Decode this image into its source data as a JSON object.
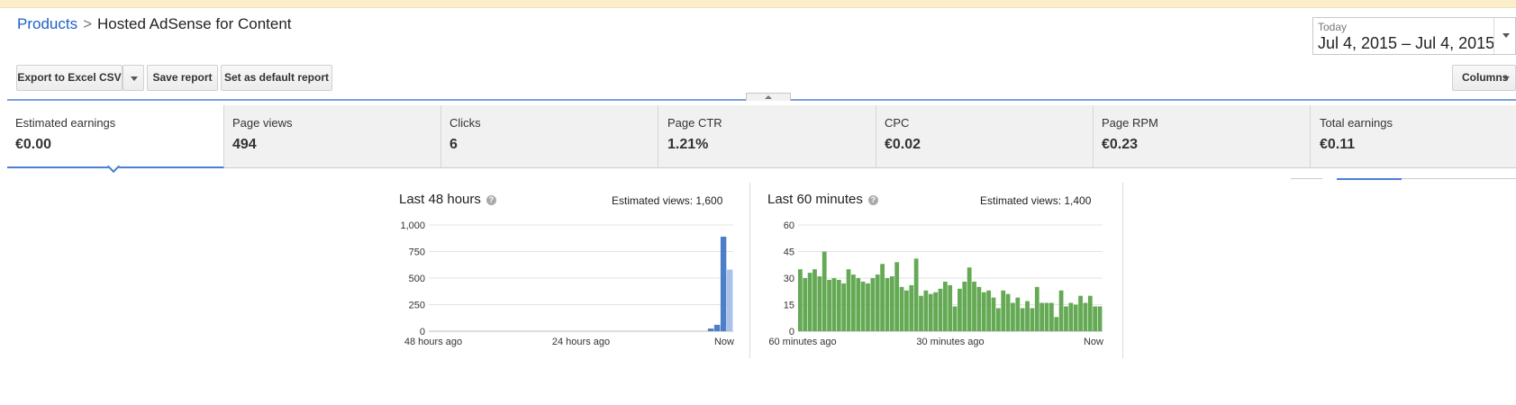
{
  "breadcrumb": {
    "root": "Products",
    "separator": ">",
    "current": "Hosted AdSense for Content"
  },
  "date_range": {
    "label": "Today",
    "value": "Jul 4, 2015 – Jul 4, 2015"
  },
  "toolbar": {
    "export_label": "Export to Excel CSV",
    "save_label": "Save report",
    "default_label": "Set as default report",
    "columns_label": "Columns"
  },
  "metrics": [
    {
      "name": "Estimated earnings",
      "value": "€0.00"
    },
    {
      "name": "Page views",
      "value": "494"
    },
    {
      "name": "Clicks",
      "value": "6"
    },
    {
      "name": "Page CTR",
      "value": "1.21%"
    },
    {
      "name": "CPC",
      "value": "€0.02"
    },
    {
      "name": "Page RPM",
      "value": "€0.23"
    },
    {
      "name": "Total earnings",
      "value": "€0.11"
    }
  ],
  "colors": {
    "accent": "#4a7fd4",
    "link": "#1a62c9",
    "bar48": "#4d7fc9",
    "bar48_light": "#a8c2ea",
    "bar60": "#64a954"
  },
  "chart_data": [
    {
      "type": "bar",
      "title": "Last 48 hours",
      "estimated_views": "Estimated views: 1,600",
      "x_tick_labels": [
        "48 hours ago",
        "24 hours ago",
        "Now"
      ],
      "y_ticks": [
        "0",
        "250",
        "500",
        "750",
        "1,000"
      ],
      "ylim": [
        0,
        1000
      ],
      "values": [
        0,
        0,
        0,
        0,
        0,
        0,
        0,
        0,
        0,
        0,
        0,
        0,
        0,
        0,
        0,
        0,
        0,
        0,
        0,
        0,
        0,
        0,
        0,
        0,
        0,
        0,
        0,
        0,
        0,
        0,
        0,
        0,
        0,
        0,
        0,
        0,
        0,
        0,
        0,
        0,
        0,
        0,
        0,
        0,
        25,
        60,
        890,
        580
      ],
      "partial_last": true
    },
    {
      "type": "bar",
      "title": "Last 60 minutes",
      "estimated_views": "Estimated views: 1,400",
      "x_tick_labels": [
        "60 minutes ago",
        "30 minutes ago",
        "Now"
      ],
      "y_ticks": [
        "0",
        "15",
        "30",
        "45",
        "60"
      ],
      "ylim": [
        0,
        60
      ],
      "values": [
        35,
        30,
        33,
        35,
        31,
        45,
        29,
        30,
        29,
        27,
        35,
        32,
        30,
        28,
        27,
        30,
        32,
        38,
        30,
        31,
        39,
        25,
        23,
        26,
        41,
        20,
        23,
        21,
        22,
        24,
        28,
        26,
        14,
        24,
        28,
        36,
        28,
        25,
        22,
        23,
        19,
        13,
        23,
        21,
        16,
        19,
        13,
        17,
        13,
        25,
        16,
        16,
        16,
        8,
        23,
        14,
        16,
        15,
        20,
        16,
        20,
        14,
        14
      ]
    }
  ]
}
